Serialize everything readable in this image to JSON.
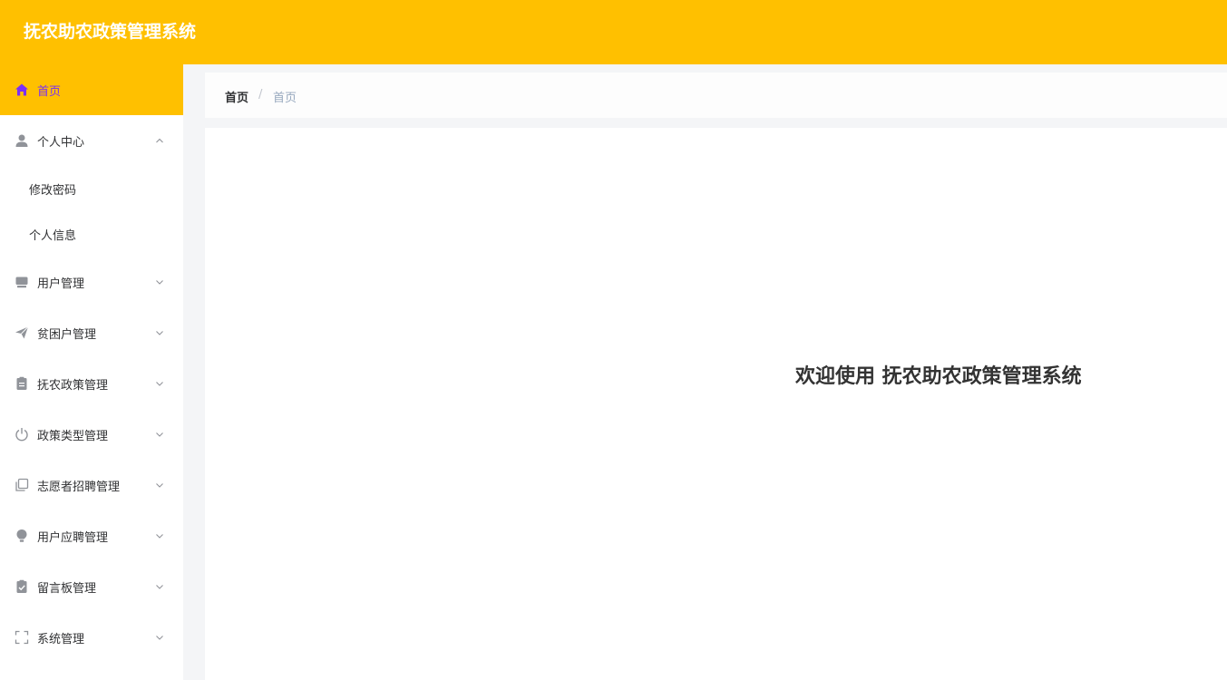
{
  "header": {
    "title": "抚农助农政策管理系统",
    "background": "#ffc000"
  },
  "sidebar": {
    "accent": "#ffc000",
    "active_text_color": "#7b2ff7",
    "items": [
      {
        "label": "首页",
        "icon": "home-icon",
        "active": true
      },
      {
        "label": "个人中心",
        "icon": "user-icon",
        "expanded": true,
        "children": [
          {
            "label": "修改密码"
          },
          {
            "label": "个人信息"
          }
        ]
      },
      {
        "label": "用户管理",
        "icon": "monitor-icon"
      },
      {
        "label": "贫困户管理",
        "icon": "send-icon"
      },
      {
        "label": "抚农政策管理",
        "icon": "clipboard-icon"
      },
      {
        "label": "政策类型管理",
        "icon": "power-icon"
      },
      {
        "label": "志愿者招聘管理",
        "icon": "copy-icon"
      },
      {
        "label": "用户应聘管理",
        "icon": "bulb-icon"
      },
      {
        "label": "留言板管理",
        "icon": "checklist-icon"
      },
      {
        "label": "系统管理",
        "icon": "fullscreen-icon"
      }
    ]
  },
  "breadcrumb": {
    "home": "首页",
    "separator": "/",
    "current": "首页"
  },
  "main": {
    "welcome": "欢迎使用 抚农助农政策管理系统"
  }
}
